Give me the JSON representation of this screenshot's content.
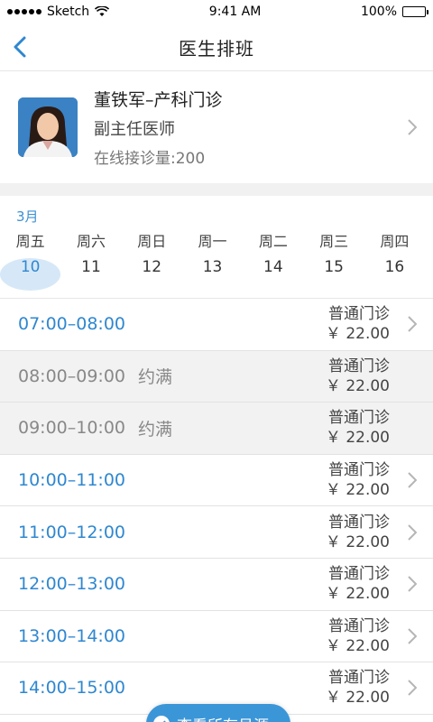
{
  "status_bar": {
    "carrier": "Sketch",
    "time": "9:41 AM",
    "battery": "100%"
  },
  "nav": {
    "title": "医生排班"
  },
  "doctor": {
    "name": "董铁军–产科门诊",
    "title": "副主任医师",
    "online_count": "在线接诊量:200"
  },
  "calendar": {
    "month": "3月",
    "weekdays": [
      "周五",
      "周六",
      "周日",
      "周一",
      "周二",
      "周三",
      "周四"
    ],
    "dates": [
      "10",
      "11",
      "12",
      "13",
      "14",
      "15",
      "16"
    ],
    "selected_index": 0
  },
  "slots": [
    {
      "time": "07:00–08:00",
      "status": "",
      "type": "普通门诊",
      "price": "￥ 22.00"
    },
    {
      "time": "08:00–09:00",
      "status": "约满",
      "type": "普通门诊",
      "price": "￥ 22.00"
    },
    {
      "time": "09:00–10:00",
      "status": "约满",
      "type": "普通门诊",
      "price": "￥ 22.00"
    },
    {
      "time": "10:00–11:00",
      "status": "",
      "type": "普通门诊",
      "price": "￥ 22.00"
    },
    {
      "time": "11:00–12:00",
      "status": "",
      "type": "普通门诊",
      "price": "￥ 22.00"
    },
    {
      "time": "12:00–13:00",
      "status": "",
      "type": "普通门诊",
      "price": "￥ 22.00"
    },
    {
      "time": "13:00–14:00",
      "status": "",
      "type": "普通门诊",
      "price": "￥ 22.00"
    },
    {
      "time": "14:00–15:00",
      "status": "",
      "type": "普通门诊",
      "price": "￥ 22.00"
    }
  ],
  "floating_button": {
    "label": "查看所有号源"
  },
  "colors": {
    "accent": "#2f87d0",
    "full_bg": "#f2f2f2",
    "button_bg": "#3b96d8"
  }
}
